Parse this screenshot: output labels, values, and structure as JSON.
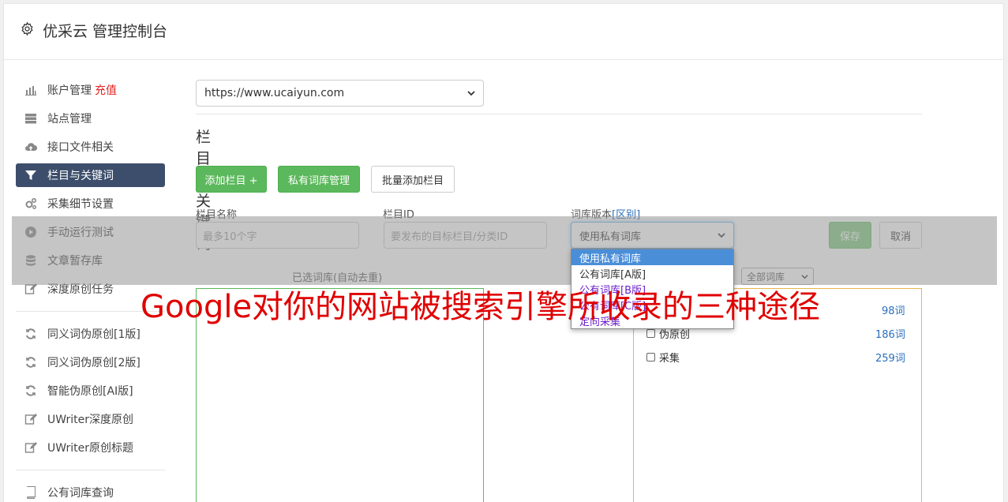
{
  "app": {
    "title": "优采云 管理控制台"
  },
  "sidebar": {
    "items": [
      {
        "label": "账户管理",
        "badge": "充值",
        "icon": "bar-chart-icon"
      },
      {
        "label": "站点管理",
        "icon": "server-icon"
      },
      {
        "label": "接口文件相关",
        "icon": "cloud-upload-icon"
      },
      {
        "label": "栏目与关键词",
        "icon": "filter-icon",
        "active": true
      },
      {
        "label": "采集细节设置",
        "icon": "cogs-icon"
      },
      {
        "label": "手动运行测试",
        "icon": "play-circle-icon"
      },
      {
        "label": "文章暂存库",
        "icon": "database-icon"
      },
      {
        "label": "深度原创任务",
        "icon": "edit-icon"
      },
      {
        "label": "同义词伪原创[1版]",
        "icon": "refresh-icon"
      },
      {
        "label": "同义词伪原创[2版]",
        "icon": "refresh-icon"
      },
      {
        "label": "智能伪原创[AI版]",
        "icon": "refresh-icon"
      },
      {
        "label": "UWriter深度原创",
        "icon": "edit-icon"
      },
      {
        "label": "UWriter原创标题",
        "icon": "edit-icon"
      },
      {
        "label": "公有词库查询",
        "icon": "book-icon"
      }
    ]
  },
  "main": {
    "site_select": "https://www.ucaiyun.com",
    "section_title": "栏目与关键词",
    "buttons": {
      "add_column": "添加栏目 +",
      "private_lib": "私有词库管理",
      "batch_add": "批量添加栏目"
    },
    "form": {
      "name_label": "栏目名称",
      "name_placeholder": "最多10个字",
      "id_label": "栏目ID",
      "id_placeholder": "要发布的目标栏目/分类ID",
      "version_label": "词库版本",
      "version_link": "[区别]",
      "version_value": "使用私有词库",
      "save": "保存",
      "cancel": "取消"
    },
    "selected_label": "已选词库(自动去重)",
    "filter_select": "全部词库",
    "libraries": [
      {
        "label": "",
        "count": "98词"
      },
      {
        "label": "伪原创",
        "count": "186词"
      },
      {
        "label": "采集",
        "count": "259词"
      }
    ],
    "dropdown_options": [
      {
        "label": "使用私有词库",
        "selected": true
      },
      {
        "label": "公有词库[A版]"
      },
      {
        "label": "公有词库[B版]"
      },
      {
        "label": "公有词库[C版]"
      },
      {
        "label": "定向采集"
      }
    ]
  },
  "overlay_caption": "Google对你的网站被搜索引擎所收录的三种途径",
  "colors": {
    "active_nav": "#3c4e6b",
    "green": "#5cb85c",
    "red_caption": "#e00000",
    "link": "#2a6ebb"
  }
}
